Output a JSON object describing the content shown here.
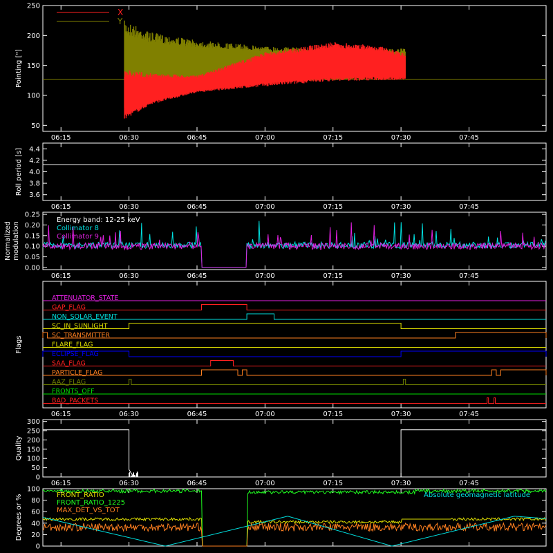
{
  "colors": {
    "background": "#000000",
    "axis": "#ffffff",
    "red": "#ff2020",
    "olive": "#808000",
    "cyan": "#00e0e0",
    "magenta": "#e020e0",
    "yellow": "#e0e000",
    "green": "#00e000",
    "blue": "#0000ff",
    "orange": "#ff8020",
    "lime": "#20ff20",
    "olivegreen": "#708000"
  },
  "chart_data": [
    {
      "type": "line",
      "id": "pointing",
      "ylabel": "Pointing [\"]",
      "xlim": [
        "06:11",
        "08:02"
      ],
      "xticks": [
        "06:15",
        "06:30",
        "06:45",
        "07:00",
        "07:15",
        "07:30",
        "07:45"
      ],
      "ylim": [
        40,
        250
      ],
      "yticks": [
        50,
        100,
        150,
        200,
        250
      ],
      "legend": {
        "placement": "top-left",
        "entries": [
          {
            "name": "X",
            "color": "#ff2020"
          },
          {
            "name": "Y",
            "color": "#808000"
          }
        ]
      },
      "baseline": 127,
      "series": [
        {
          "name": "Y",
          "color": "#808000",
          "envelope": {
            "t": [
              "06:29",
              "06:35",
              "06:45",
              "07:00",
              "07:15",
              "07:25",
              "07:31"
            ],
            "upper": [
              225,
              205,
              192,
              182,
              178,
              178,
              178
            ],
            "lower": [
              65,
              90,
              112,
              123,
              125,
              128,
              128
            ]
          }
        },
        {
          "name": "X",
          "color": "#ff2020",
          "envelope": {
            "t": [
              "06:29",
              "06:35",
              "06:45",
              "07:00",
              "07:15",
              "07:25",
              "07:31"
            ],
            "upper": [
              143,
              137,
              133,
              172,
              189,
              183,
              170
            ],
            "lower": [
              60,
              85,
              105,
              115,
              124,
              125,
              126
            ]
          }
        }
      ]
    },
    {
      "type": "line",
      "id": "roll",
      "ylabel": "Roll period [s]",
      "ylim": [
        3.5,
        4.5
      ],
      "yticks": [
        "3.6",
        "3.8",
        "4.0",
        "4.2",
        "4.4"
      ],
      "series": [
        {
          "name": "",
          "color": "#ffffff",
          "x": [
            "06:11",
            "08:02"
          ],
          "y": [
            4.12,
            4.12
          ]
        }
      ]
    },
    {
      "type": "line",
      "id": "modulation",
      "ylabel": "Normalized modulation",
      "ylim": [
        -0.01,
        0.26
      ],
      "yticks": [
        "0.00",
        "0.05",
        "0.10",
        "0.15",
        "0.20",
        "0.25"
      ],
      "annotations": [
        {
          "text": "Energy band: 12-25 keV",
          "color": "#ffffff"
        },
        {
          "text": "Collimator 8",
          "color": "#00e0e0"
        },
        {
          "text": "Collimator 9",
          "color": "#e020e0"
        }
      ],
      "series": [
        {
          "name": "Collimator 8",
          "color": "#00e0e0",
          "baseline": 0.105,
          "gap": [
            "06:46",
            "06:56"
          ],
          "gap_value": 0.0
        },
        {
          "name": "Collimator 9",
          "color": "#e020e0",
          "baseline": 0.1,
          "gap": [
            "06:46",
            "06:56"
          ],
          "gap_value": 0.0
        }
      ]
    },
    {
      "type": "line",
      "id": "flags",
      "ylabel": "Flags",
      "flags": [
        {
          "name": "ATTENUATOR_STATE",
          "color": "#e020e0",
          "high": []
        },
        {
          "name": "GAP_FLAG",
          "color": "#ff2020",
          "high": [
            [
              "06:46",
              "06:56"
            ]
          ]
        },
        {
          "name": "NON_SOLAR_EVENT",
          "color": "#00e0e0",
          "high": [
            [
              "06:56",
              "07:02"
            ]
          ]
        },
        {
          "name": "SC_IN_SUNLIGHT",
          "color": "#e0e000",
          "high": [
            [
              "06:30",
              "07:30"
            ]
          ]
        },
        {
          "name": "SC_TRANSMITTER",
          "color": "#ff8020",
          "high": [
            [
              "06:11",
              "06:12"
            ],
            [
              "07:42",
              "08:02"
            ]
          ]
        },
        {
          "name": "FLARE_FLAG",
          "color": "#e0e000",
          "high": []
        },
        {
          "name": "ECLIPSE_FLAG",
          "color": "#0000ff",
          "high": [
            [
              "06:11",
              "06:30"
            ],
            [
              "07:30",
              "08:02"
            ]
          ]
        },
        {
          "name": "SAA_FLAG",
          "color": "#ff2020",
          "high": [
            [
              "06:48",
              "06:53"
            ]
          ]
        },
        {
          "name": "PARTICLE_FLAG",
          "color": "#ff8020",
          "high": [
            [
              "06:46",
              "06:54"
            ],
            [
              "06:55",
              "06:56"
            ],
            [
              "07:50",
              "07:51"
            ],
            [
              "07:52",
              "08:02"
            ]
          ]
        },
        {
          "name": "AAZ_FLAG",
          "color": "#708000",
          "high": [
            [
              "06:30",
              "06:30.5"
            ],
            [
              "07:30.5",
              "07:31"
            ]
          ]
        },
        {
          "name": "FRONTS_OFF",
          "color": "#00e000",
          "high": []
        },
        {
          "name": "BAD_PACKETS",
          "color": "#ff2020",
          "high": [
            [
              "07:49",
              "07:49.3"
            ],
            [
              "07:50.5",
              "07:50.8"
            ]
          ]
        }
      ]
    },
    {
      "type": "line",
      "id": "quality",
      "ylabel": "Quality",
      "ylim": [
        0,
        310
      ],
      "yticks": [
        0,
        50,
        100,
        150,
        200,
        250,
        300
      ],
      "series": [
        {
          "name": "",
          "color": "#ffffff",
          "x": [
            "06:11",
            "06:30",
            "06:30",
            "06:31",
            "06:31",
            "07:30",
            "07:30",
            "08:02"
          ],
          "y": [
            255,
            255,
            40,
            0,
            0,
            0,
            255,
            255
          ]
        }
      ]
    },
    {
      "type": "line",
      "id": "ratios",
      "ylabel": "Degrees or %",
      "ylim": [
        0,
        100
      ],
      "yticks": [
        0,
        20,
        40,
        60,
        80,
        100
      ],
      "annotations": [
        {
          "text": "Absolute geomagnetic latitude",
          "color": "#00e0e0"
        }
      ],
      "legend": {
        "placement": "top-left",
        "entries": [
          {
            "name": "FRONT_RATIO",
            "color": "#e0e000"
          },
          {
            "name": "FRONT_RATIO_1225",
            "color": "#20ff20"
          },
          {
            "name": "MAX_DET_VS_TOT",
            "color": "#ff8020"
          }
        ]
      },
      "series": [
        {
          "name": "FRONT_RATIO",
          "color": "#e0e000",
          "levels": [
            {
              "from": "06:11",
              "to": "06:46",
              "y": 47
            },
            {
              "from": "06:56",
              "to": "07:30",
              "y": 42
            },
            {
              "from": "07:41",
              "to": "08:02",
              "y": 47
            }
          ]
        },
        {
          "name": "FRONT_RATIO_1225",
          "color": "#20ff20",
          "levels": [
            {
              "from": "06:11",
              "to": "06:46",
              "y": 96
            },
            {
              "from": "06:56",
              "to": "07:33",
              "y": 94
            },
            {
              "from": "07:33",
              "to": "08:02",
              "y": 96
            }
          ]
        },
        {
          "name": "MAX_DET_VS_TOT",
          "color": "#ff8020",
          "baseline": 33
        },
        {
          "name": "Absolute geomagnetic latitude",
          "color": "#00e0e0",
          "x": [
            "06:11",
            "06:38",
            "07:05",
            "07:28",
            "07:55",
            "08:02"
          ],
          "y": [
            50,
            0,
            52,
            0,
            52,
            48
          ]
        }
      ]
    }
  ]
}
